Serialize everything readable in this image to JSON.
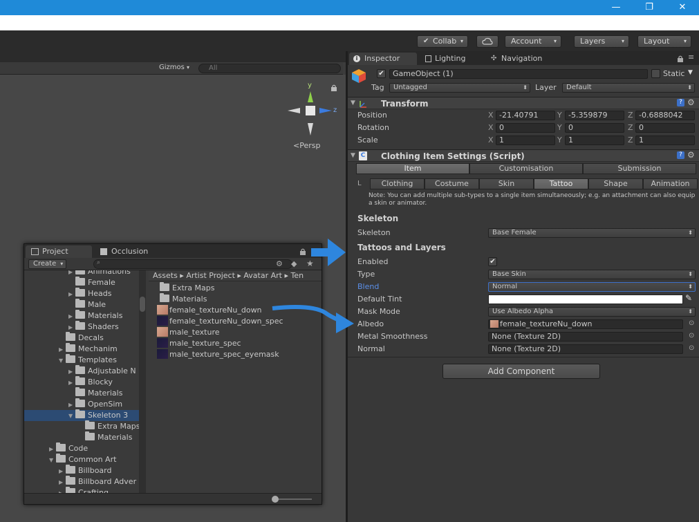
{
  "window": {
    "btn_minimize": "—",
    "btn_maximize": "❐",
    "btn_close": "✕"
  },
  "toolbar": {
    "collab": "Collab",
    "account": "Account",
    "layers": "Layers",
    "layout": "Layout",
    "dropdown_glyph": "▾"
  },
  "scene": {
    "gizmos": "Gizmos",
    "search_placeholder": "All",
    "persp": "Persp",
    "axis_y": "y",
    "axis_z": "z"
  },
  "project": {
    "tab_project": "Project",
    "tab_occlusion": "Occlusion",
    "create": "Create",
    "breadcrumb": "Assets ▸ Artist Project ▸ Avatar Art ▸ Ten",
    "tree": [
      {
        "label": "Animations",
        "expand": "▶"
      },
      {
        "label": "Female",
        "expand": ""
      },
      {
        "label": "Heads",
        "expand": "▶"
      },
      {
        "label": "Male",
        "expand": ""
      },
      {
        "label": "Materials",
        "expand": "▶"
      },
      {
        "label": "Shaders",
        "expand": "▶"
      },
      {
        "label": "Decals",
        "expand": ""
      },
      {
        "label": "Mechanim",
        "expand": "▶"
      },
      {
        "label": "Templates",
        "expand": "▼"
      },
      {
        "label": "Adjustable N",
        "expand": "▶"
      },
      {
        "label": "Blocky",
        "expand": "▶"
      },
      {
        "label": "Materials",
        "expand": ""
      },
      {
        "label": "OpenSim",
        "expand": "▶"
      },
      {
        "label": "Skeleton 3",
        "expand": "▼"
      },
      {
        "label": "Extra Maps",
        "expand": ""
      },
      {
        "label": "Materials",
        "expand": ""
      },
      {
        "label": "Code",
        "expand": "▶"
      },
      {
        "label": "Common Art",
        "expand": "▼"
      },
      {
        "label": "Billboard",
        "expand": "▶"
      },
      {
        "label": "Billboard Adver",
        "expand": "▶"
      },
      {
        "label": "Crafting",
        "expand": "▶"
      }
    ],
    "files": [
      {
        "label": "Extra Maps",
        "kind": "folder"
      },
      {
        "label": "Materials",
        "kind": "folder"
      },
      {
        "label": "female_textureNu_down",
        "kind": "skin"
      },
      {
        "label": "female_textureNu_down_spec",
        "kind": "dark"
      },
      {
        "label": "male_texture",
        "kind": "skin"
      },
      {
        "label": "male_texture_spec",
        "kind": "dark"
      },
      {
        "label": "male_texture_spec_eyemask",
        "kind": "dark"
      }
    ]
  },
  "inspector": {
    "tab_inspector": "Inspector",
    "tab_lighting": "Lighting",
    "tab_navigation": "Navigation",
    "gameobject_name": "GameObject (1)",
    "static_label": "Static",
    "tag_label": "Tag",
    "tag_value": "Untagged",
    "layer_label": "Layer",
    "layer_value": "Default",
    "transform": {
      "title": "Transform",
      "rows": [
        {
          "label": "Position",
          "x": "-21.40791",
          "y": "-5.359879",
          "z": "-0.6888042"
        },
        {
          "label": "Rotation",
          "x": "0",
          "y": "0",
          "z": "0"
        },
        {
          "label": "Scale",
          "x": "1",
          "y": "1",
          "z": "1"
        }
      ],
      "axis_x": "X",
      "axis_y": "Y",
      "axis_z": "Z"
    },
    "script": {
      "title": "Clothing Item Settings (Script)",
      "main_tabs": [
        "Item",
        "Customisation",
        "Submission"
      ],
      "sub_tabs": [
        "Clothing",
        "Costume",
        "Skin",
        "Tattoo",
        "Shape",
        "Animation"
      ],
      "active_main": "Item",
      "active_sub": "Tattoo",
      "note": "Note: You can add multiple sub-types to a single item simultaneously; e.g. an attachment can also equip a skin or animator.",
      "skeleton_header": "Skeleton",
      "skeleton_label": "Skeleton",
      "skeleton_value": "Base Female",
      "tattoos_header": "Tattoos and Layers",
      "enabled_label": "Enabled",
      "type_label": "Type",
      "type_value": "Base Skin",
      "blend_label": "Blend",
      "blend_value": "Normal",
      "default_tint_label": "Default Tint",
      "mask_mode_label": "Mask Mode",
      "mask_mode_value": "Use Albedo Alpha",
      "albedo_label": "Albedo",
      "albedo_value": "female_textureNu_down",
      "metal_label": "Metal Smoothness",
      "metal_value": "None (Texture 2D)",
      "normal_label": "Normal",
      "normal_value": "None (Texture 2D)"
    },
    "add_component": "Add Component"
  },
  "colors": {
    "titlebar": "#1f8ad8",
    "accent_blue": "#2e86de",
    "blend_label": "#5b8fe8"
  }
}
